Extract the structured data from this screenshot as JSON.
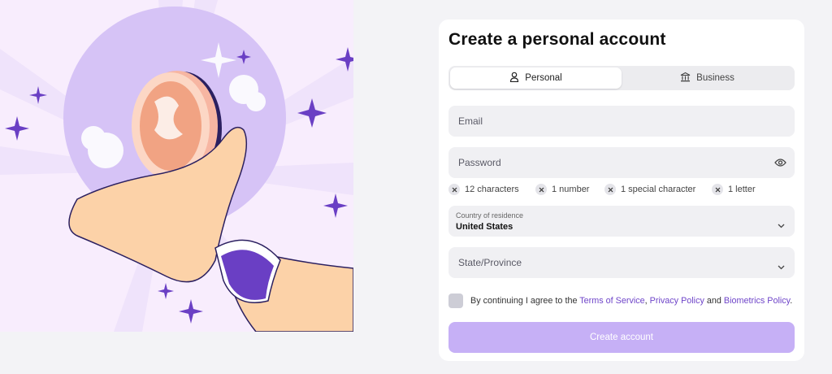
{
  "form": {
    "title": "Create a personal account",
    "account_types": [
      {
        "label": "Personal",
        "icon": "person-icon",
        "selected": true
      },
      {
        "label": "Business",
        "icon": "bank-icon",
        "selected": false
      }
    ],
    "email_placeholder": "Email",
    "password_placeholder": "Password",
    "password_rules": [
      "12 characters",
      "1 number",
      "1 special character",
      "1 letter"
    ],
    "country": {
      "label": "Country of residence",
      "value": "United States"
    },
    "state_placeholder": "State/Province",
    "agreement": {
      "prefix": "By continuing I agree to the",
      "terms": "Terms of Service",
      "sep": ",",
      "privacy": "Privacy Policy",
      "and": "and",
      "biometrics": "Biometrics Policy",
      "suffix": "."
    },
    "submit_label": "Create account"
  },
  "colors": {
    "accent": "#6f45c9",
    "button_disabled": "#c6b0f6",
    "hero_background": "#f8edfd",
    "hero_circle": "#d6c3f6"
  }
}
